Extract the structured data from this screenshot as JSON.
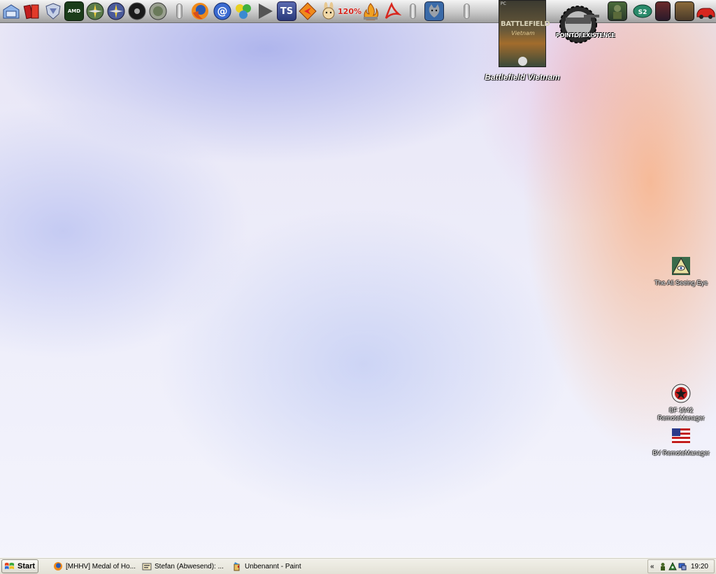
{
  "dock": {
    "icons": [
      {
        "name": "explorer-icon"
      },
      {
        "name": "red-books-icon"
      },
      {
        "name": "shield-icon"
      },
      {
        "name": "amd-icon",
        "text": "AMD"
      },
      {
        "name": "compass-green-icon"
      },
      {
        "name": "compass-blue-icon"
      },
      {
        "name": "black-disc-icon"
      },
      {
        "name": "grey-disc-icon"
      },
      {
        "name": "firefox-icon"
      },
      {
        "name": "mail-icon"
      },
      {
        "name": "colorful-icon"
      },
      {
        "name": "play-arrow-icon"
      },
      {
        "name": "teamspeak-icon",
        "text": "TS"
      },
      {
        "name": "orange-diamond-icon"
      },
      {
        "name": "rabbit-icon"
      },
      {
        "name": "zoom-percent-icon",
        "text": "120%"
      },
      {
        "name": "acrobat-icon"
      },
      {
        "name": "flame-icon"
      },
      {
        "name": "pdf-icon"
      },
      {
        "name": "cat-icon"
      },
      {
        "name": "soldier-icon"
      },
      {
        "name": "sims-icon"
      },
      {
        "name": "game-cover-icon"
      },
      {
        "name": "game-cover-2-icon"
      },
      {
        "name": "red-car-icon"
      }
    ],
    "bfv_label": "Battlefield Vietnam",
    "bfv_cover": {
      "pc": "PC",
      "title": "BATTLEFIELD",
      "sub": "Vietnam"
    },
    "poe_label": "POINTOFEXISTENCE"
  },
  "desktop": {
    "icons": [
      {
        "label": "The All Seeing Eye"
      },
      {
        "label_line1": "BF 1942",
        "label_line2": "RemoteManager"
      },
      {
        "label": "BV RemoteManager"
      }
    ]
  },
  "taskbar": {
    "start_label": "Start",
    "tasks": [
      {
        "label": "[MHHV] Medal of Ho..."
      },
      {
        "label": "Stefan (Abwesend): ..."
      },
      {
        "label": "Unbenannt - Paint"
      }
    ],
    "tray": {
      "chevron": "«",
      "clock": "19:20"
    }
  },
  "colors": {
    "taskbar_bg": "#e8e6dc",
    "dock_bg": "#c9c9c9",
    "teamspeak": "#3a4a8a",
    "acrobat_red": "#d8261e"
  }
}
